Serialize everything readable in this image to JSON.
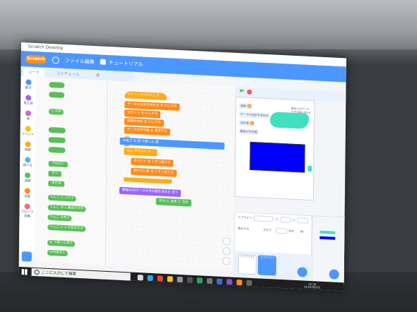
{
  "window": {
    "title": "Scratch Desktop"
  },
  "menubar": {
    "logo": "Scratch",
    "file": "ファイル",
    "edit": "編集",
    "tutorial": "チュートリアル"
  },
  "tabs": {
    "code": "コード",
    "costumes": "コスチューム",
    "sounds": "音"
  },
  "categories": [
    {
      "label": "動き",
      "color": "#4c97ff"
    },
    {
      "label": "見た目",
      "color": "#9966ff"
    },
    {
      "label": "音",
      "color": "#cf63cf"
    },
    {
      "label": "イベント",
      "color": "#ffbf00"
    },
    {
      "label": "制御",
      "color": "#ffab19"
    },
    {
      "label": "調べる",
      "color": "#5cb1d6"
    },
    {
      "label": "演算",
      "color": "#59c059"
    },
    {
      "label": "変数",
      "color": "#ff8c1a"
    },
    {
      "label": "ブロック定義",
      "color": "#ff6680"
    }
  ],
  "palette": {
    "blocks": [
      "と の和",
      "ではない",
      "かつ",
      "または",
      "ではない",
      "りんご と バナナ",
      "りんご の 1 番目の文字",
      "りんご の長さ",
      "りんご に a が含まれる",
      "を で割った余り",
      "の四捨五入"
    ]
  },
  "code": {
    "hat": "がクリックされたとき",
    "rows": [
      "データの合計を求める を 0 にする",
      "カウント を 0 にする",
      "回数の合計 を 0 にする",
      "データの平均値 を 表示する",
      "の長さ の 回 で割った 値",
      "もし カウント > ...",
      "カウント を 1 ずつ変える",
      "調べたい数 を 1 ずつ変える",
      "最後の20データの平均値を求める 言う",
      "平均 と 全体 と 合計"
    ],
    "selected_value": "0"
  },
  "stage": {
    "monitors": [
      "変数",
      "データの合計を求める",
      "合計値",
      "最後の平均値"
    ],
    "monitor_value": "0",
    "note": "最後の20データの平均値を求める"
  },
  "sprite_info": {
    "sprite_label": "スプライト",
    "x_label": "x",
    "y_label": "y",
    "show_label": "表示する",
    "size_label": "大きさ",
    "direction_label": "向き",
    "direction_value": "90"
  },
  "sprites": [
    "スプライト1",
    "スプライト2"
  ],
  "taskbar": {
    "search_placeholder": "ここに入力して検索",
    "time": "15:36",
    "date": "2019/06/05"
  },
  "colors": {
    "scratch_blue": "#4c97ff",
    "control": "#ffab19",
    "variables": "#ff8c1a",
    "operators": "#59c059",
    "my_blocks": "#ff6680",
    "stage_rect": "#0000ff",
    "stage_blob": "#40e0c0"
  }
}
